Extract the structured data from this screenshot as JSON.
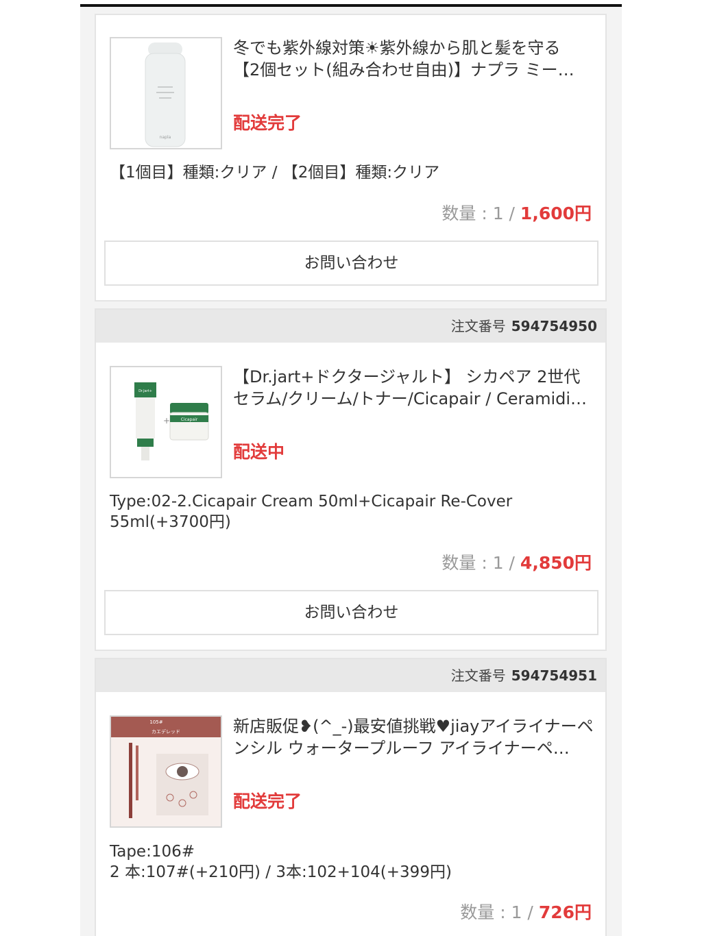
{
  "orders": [
    {
      "order_label": "",
      "order_number": "",
      "title_line1": "冬でも紫外線対策☀紫外線から肌と髪を守る",
      "title_line2": "【2個セット(組み合わせ自由)】ナプラ ミー…",
      "status": "配送完了",
      "option_line1": "【1個目】種類:クリア / 【2個目】種類:クリア",
      "option_line2": "",
      "qty_label": "数量 : 1 / ",
      "price": "1,600円",
      "inquiry_label": "お問い合わせ"
    },
    {
      "order_label": "注文番号",
      "order_number": "594754950",
      "title_line1": "【Dr.jart+ドクタージャルト】 シカペア 2世代",
      "title_line2": "セラム/クリーム/トナー/Cicapair / Ceramidin…",
      "status": "配送中",
      "option_line1": "Type:02-2.Cicapair Cream 50ml+Cicapair Re-Cover",
      "option_line2": "55ml(+3700円)",
      "qty_label": "数量 : 1 / ",
      "price": "4,850円",
      "inquiry_label": "お問い合わせ"
    },
    {
      "order_label": "注文番号",
      "order_number": "594754951",
      "title_line1": "新店販促❥(^_-)最安値挑戦♥jiayアイライナーペ",
      "title_line2": "ンシル ウォータープルーフ アイライナーペ…",
      "status": "配送完了",
      "option_line1": "Tape:106#",
      "option_line2": "2 本:107#(+210円) / 3本:102+104(+399円)",
      "qty_label": "数量 : 1 / ",
      "price": "726円"
    }
  ],
  "thumbnails": {
    "napla_bottle_text": "napla",
    "drjart_tube_text": "Dr.Jart+",
    "drjart_jar_text": "Cicapair",
    "eyeliner_code": "105#",
    "eyeliner_name": "カエデレッド"
  },
  "colors": {
    "status_red": "#e23b3b",
    "price_red": "#e23b3b",
    "header_gray": "#e8e8e8"
  }
}
